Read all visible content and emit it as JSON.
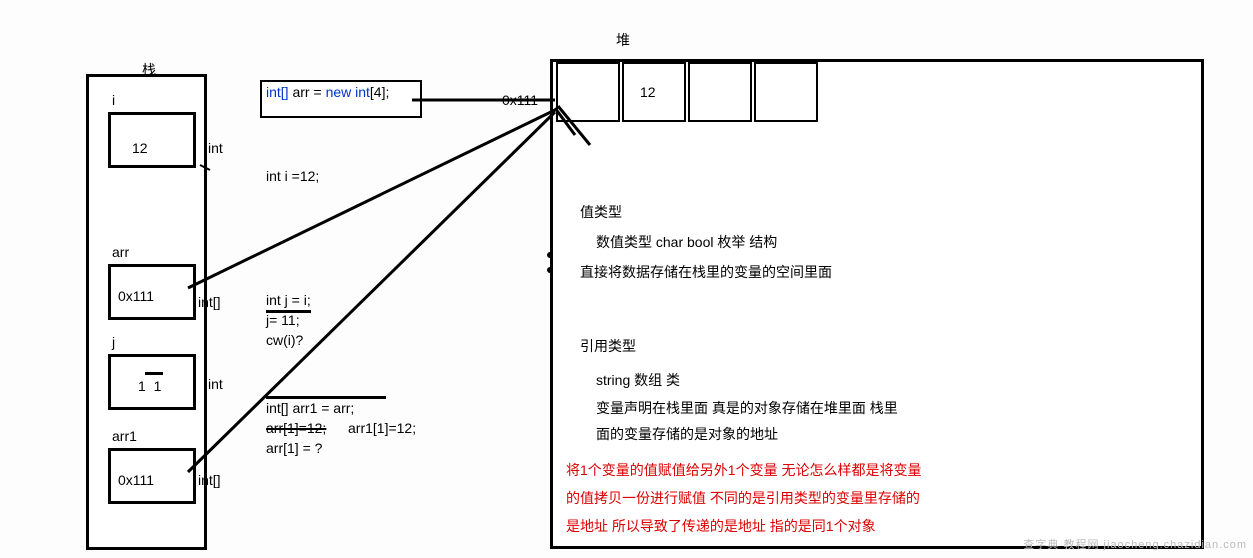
{
  "stack": {
    "title": "栈",
    "vars": {
      "i": {
        "name": "i",
        "value": "12",
        "type": "int"
      },
      "arr": {
        "name": "arr",
        "value": "0x111",
        "type": "int[]"
      },
      "j": {
        "name": "j",
        "value": "1  1",
        "type_struck": "int",
        "type": "int"
      },
      "arr1": {
        "name": "arr1",
        "value": "0x111",
        "type": "int[]"
      }
    }
  },
  "heap": {
    "title": "堆",
    "address": "0x111",
    "cells": {
      "cell1": "12"
    }
  },
  "code": {
    "arr_decl_kw1": "int[]",
    "arr_decl_name": "arr",
    "arr_decl_eq": "=",
    "arr_decl_new": "new int",
    "arr_decl_bracket": "[4];",
    "int_i": "int i =12;",
    "int_j_struck": "int j = i;",
    "j11": "j= 11;",
    "cwi": "cw(i)?",
    "arr1_decl": "int[] arr1 = arr;",
    "arr1_struck": "arr[1]=12;",
    "arr1_assign": "arr1[1]=12;",
    "arr1_q": "arr[1] = ?"
  },
  "explain": {
    "value_type_header": "值类型",
    "value_type_line1": "数值类型 char bool 枚举 结构",
    "value_type_line2": "直接将数据存储在栈里的变量的空间里面",
    "ref_type_header": "引用类型",
    "ref_type_line1": "string 数组 类",
    "ref_type_line2": "变量声明在栈里面 真是的对象存储在堆里面 栈里",
    "ref_type_line3": "面的变量存储的是对象的地址",
    "red1": "将1个变量的值赋值给另外1个变量 无论怎么样都是将变量",
    "red2": "的值拷贝一份进行赋值 不同的是引用类型的变量里存储的",
    "red3": "是地址 所以导致了传递的是地址 指的是同1个对象"
  },
  "watermark": "查字典 教程网  jiaocheng.chazidian.com"
}
